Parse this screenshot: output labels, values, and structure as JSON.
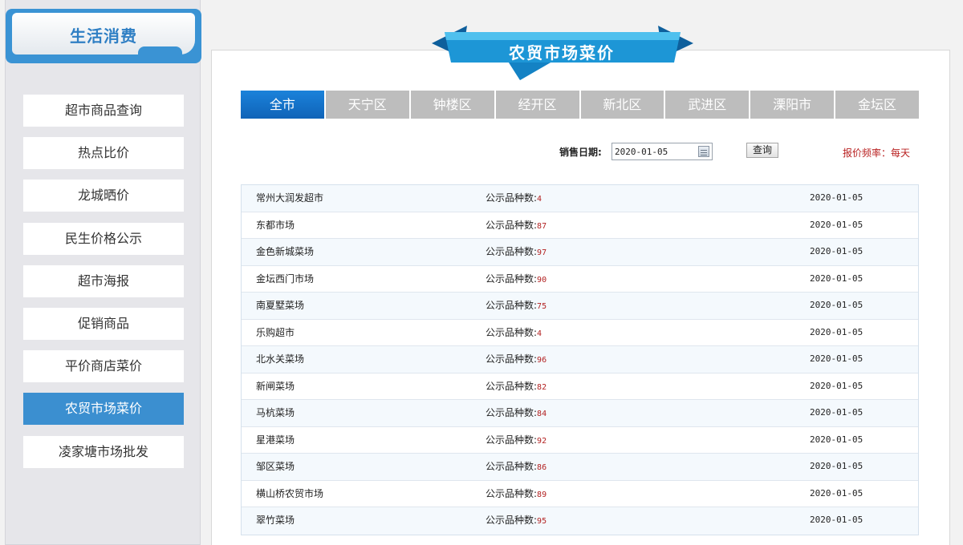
{
  "sidebar": {
    "title": "生活消费",
    "items": [
      {
        "label": "超市商品查询",
        "active": false
      },
      {
        "label": "热点比价",
        "active": false
      },
      {
        "label": "龙城晒价",
        "active": false
      },
      {
        "label": "民生价格公示",
        "active": false
      },
      {
        "label": "超市海报",
        "active": false
      },
      {
        "label": "促销商品",
        "active": false
      },
      {
        "label": "平价商店菜价",
        "active": false
      },
      {
        "label": "农贸市场菜价",
        "active": true
      },
      {
        "label": "凌家塘市场批发",
        "active": false
      }
    ]
  },
  "header": {
    "title": "农贸市场菜价"
  },
  "tabs": [
    "全市",
    "天宁区",
    "钟楼区",
    "经开区",
    "新北区",
    "武进区",
    "溧阳市",
    "金坛区"
  ],
  "active_tab": "全市",
  "query": {
    "date_label": "销售日期:",
    "date_value": "2020-01-05",
    "button_label": "查询",
    "frequency": "报价频率：每天"
  },
  "markets": [
    {
      "name": "常州大润发超市",
      "count_label": "公示品种数:",
      "count": "4",
      "date": "2020-01-05"
    },
    {
      "name": "东都市场",
      "count_label": "公示品种数:",
      "count": "87",
      "date": "2020-01-05"
    },
    {
      "name": "金色新城菜场",
      "count_label": "公示品种数:",
      "count": "97",
      "date": "2020-01-05"
    },
    {
      "name": "金坛西门市场",
      "count_label": "公示品种数:",
      "count": "90",
      "date": "2020-01-05"
    },
    {
      "name": "南夏墅菜场",
      "count_label": "公示品种数:",
      "count": "75",
      "date": "2020-01-05"
    },
    {
      "name": "乐购超市",
      "count_label": "公示品种数:",
      "count": "4",
      "date": "2020-01-05"
    },
    {
      "name": "北水关菜场",
      "count_label": "公示品种数:",
      "count": "96",
      "date": "2020-01-05"
    },
    {
      "name": "新闸菜场",
      "count_label": "公示品种数:",
      "count": "82",
      "date": "2020-01-05"
    },
    {
      "name": "马杭菜场",
      "count_label": "公示品种数:",
      "count": "84",
      "date": "2020-01-05"
    },
    {
      "name": "星港菜场",
      "count_label": "公示品种数:",
      "count": "92",
      "date": "2020-01-05"
    },
    {
      "name": "邹区菜场",
      "count_label": "公示品种数:",
      "count": "86",
      "date": "2020-01-05"
    },
    {
      "name": "横山桥农贸市场",
      "count_label": "公示品种数:",
      "count": "89",
      "date": "2020-01-05"
    },
    {
      "name": "翠竹菜场",
      "count_label": "公示品种数:",
      "count": "95",
      "date": "2020-01-05"
    }
  ]
}
